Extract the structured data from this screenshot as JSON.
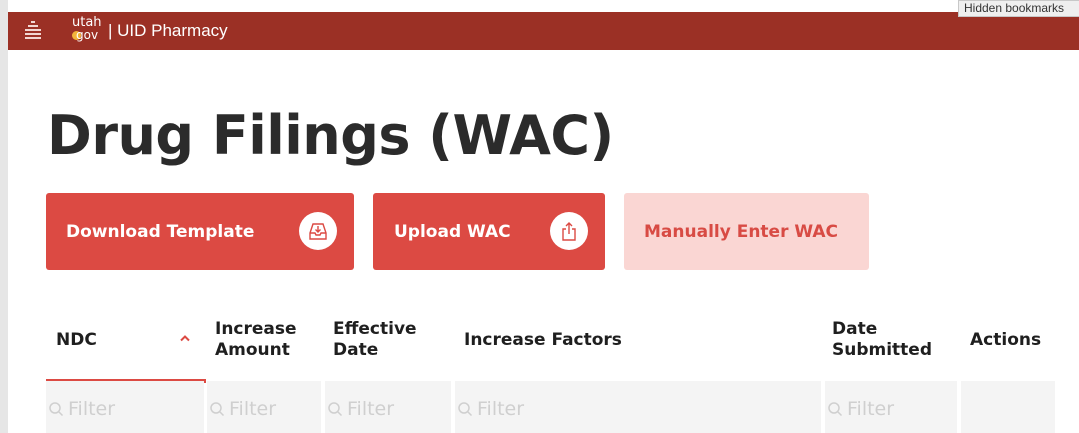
{
  "header": {
    "logo_top": "utah",
    "logo_bottom": "gov",
    "title": "| UID Pharmacy",
    "bookmarks_tooltip": "Hidden bookmarks"
  },
  "page": {
    "title": "Drug Filings (WAC)"
  },
  "actions": {
    "download": "Download Template",
    "upload": "Upload WAC",
    "manual": "Manually Enter WAC"
  },
  "table": {
    "columns": [
      {
        "label_line1": "NDC",
        "label_line2": ""
      },
      {
        "label_line1": "Increase",
        "label_line2": "Amount"
      },
      {
        "label_line1": "Effective",
        "label_line2": "Date"
      },
      {
        "label_line1": "Increase Factors",
        "label_line2": ""
      },
      {
        "label_line1": "Date",
        "label_line2": "Submitted"
      },
      {
        "label_line1": "Actions",
        "label_line2": ""
      }
    ],
    "filter_placeholder": "Filter",
    "sort_column": "NDC",
    "sort_direction": "ascending"
  },
  "colors": {
    "header_bar": "#9b3025",
    "primary_button": "#dc4a43",
    "secondary_button": "#fad6d3",
    "sun": "#f3b43a"
  },
  "icons": {
    "menu": "menu-icon",
    "download": "download-tray-icon",
    "upload": "upload-share-icon",
    "sort": "chevron-up-icon",
    "filter": "search-icon"
  }
}
